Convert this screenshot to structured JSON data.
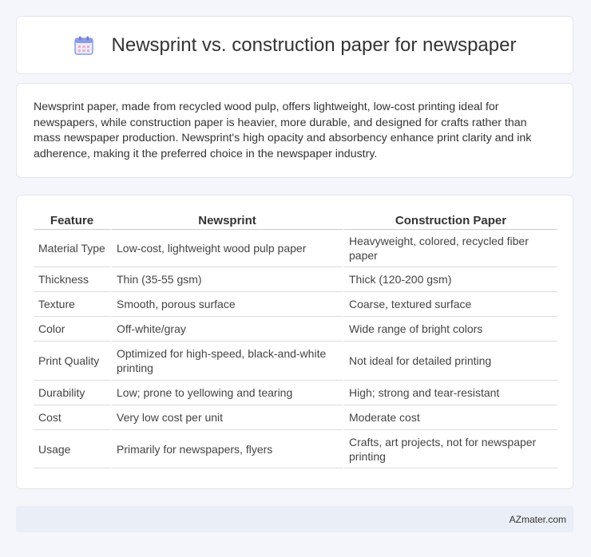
{
  "header": {
    "title": "Newsprint vs. construction paper for newspaper",
    "icon": "calendar-icon"
  },
  "summary": {
    "text": "Newsprint paper, made from recycled wood pulp, offers lightweight, low-cost printing ideal for newspapers, while construction paper is heavier, more durable, and designed for crafts rather than mass newspaper production. Newsprint's high opacity and absorbency enhance print clarity and ink adherence, making it the preferred choice in the newspaper industry."
  },
  "table": {
    "headers": [
      "Feature",
      "Newsprint",
      "Construction Paper"
    ],
    "rows": [
      [
        "Material Type",
        "Low-cost, lightweight wood pulp paper",
        "Heavyweight, colored, recycled fiber paper"
      ],
      [
        "Thickness",
        "Thin (35-55 gsm)",
        "Thick (120-200 gsm)"
      ],
      [
        "Texture",
        "Smooth, porous surface",
        "Coarse, textured surface"
      ],
      [
        "Color",
        "Off-white/gray",
        "Wide range of bright colors"
      ],
      [
        "Print Quality",
        "Optimized for high-speed, black-and-white printing",
        "Not ideal for detailed printing"
      ],
      [
        "Durability",
        "Low; prone to yellowing and tearing",
        "High; strong and tear-resistant"
      ],
      [
        "Cost",
        "Very low cost per unit",
        "Moderate cost"
      ],
      [
        "Usage",
        "Primarily for newspapers, flyers",
        "Crafts, art projects, not for newspaper printing"
      ]
    ]
  },
  "footer": {
    "text": "AZmater.com"
  }
}
